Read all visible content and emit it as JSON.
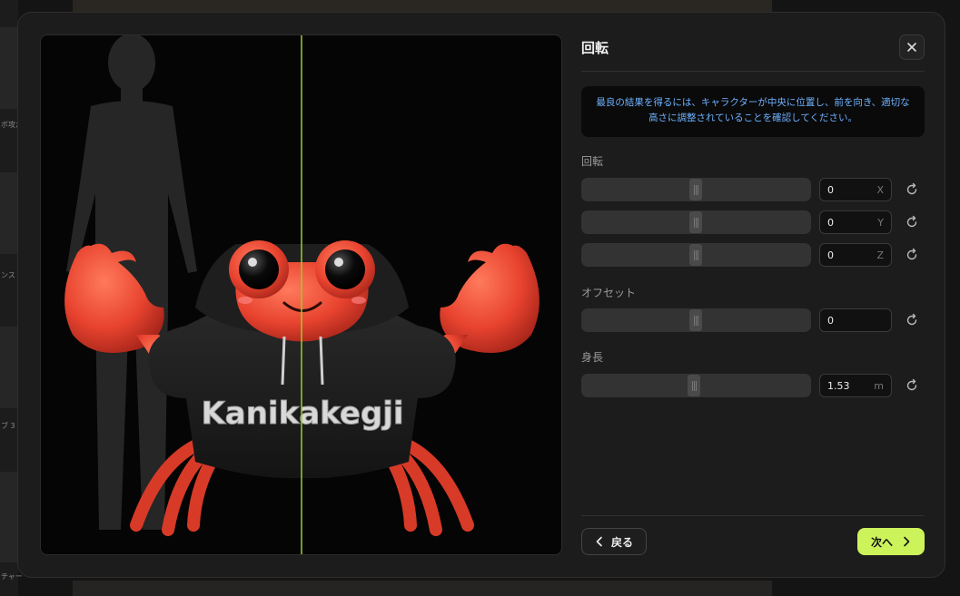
{
  "backdrop": {
    "side_labels": [
      "ボ攻か",
      "ンス",
      "ブ 3",
      "チャー"
    ]
  },
  "modal": {
    "title": "回転",
    "info_text": "最良の結果を得るには、キャラクターが中央に位置し、前を向き、適切な高さに調整されていることを確認してください。",
    "rotation": {
      "label": "回転",
      "x": {
        "value": "0",
        "unit": "X",
        "slider_fraction": 0.5
      },
      "y": {
        "value": "0",
        "unit": "Y",
        "slider_fraction": 0.5
      },
      "z": {
        "value": "0",
        "unit": "Z",
        "slider_fraction": 0.5
      }
    },
    "offset": {
      "label": "オフセット",
      "value": "0",
      "slider_fraction": 0.5
    },
    "height": {
      "label": "身長",
      "value": "1.53",
      "unit": "m",
      "slider_fraction": 0.49
    },
    "back_label": "戻る",
    "next_label": "次へ"
  },
  "preview": {
    "hoodie_text": "Kanikakegji",
    "center_line_color": "#9fc931",
    "crab_color": "#e8432f",
    "hoodie_color": "#1c1c1c"
  },
  "colors": {
    "accent": "#cdf35b",
    "info_text": "#6fb1ff"
  }
}
